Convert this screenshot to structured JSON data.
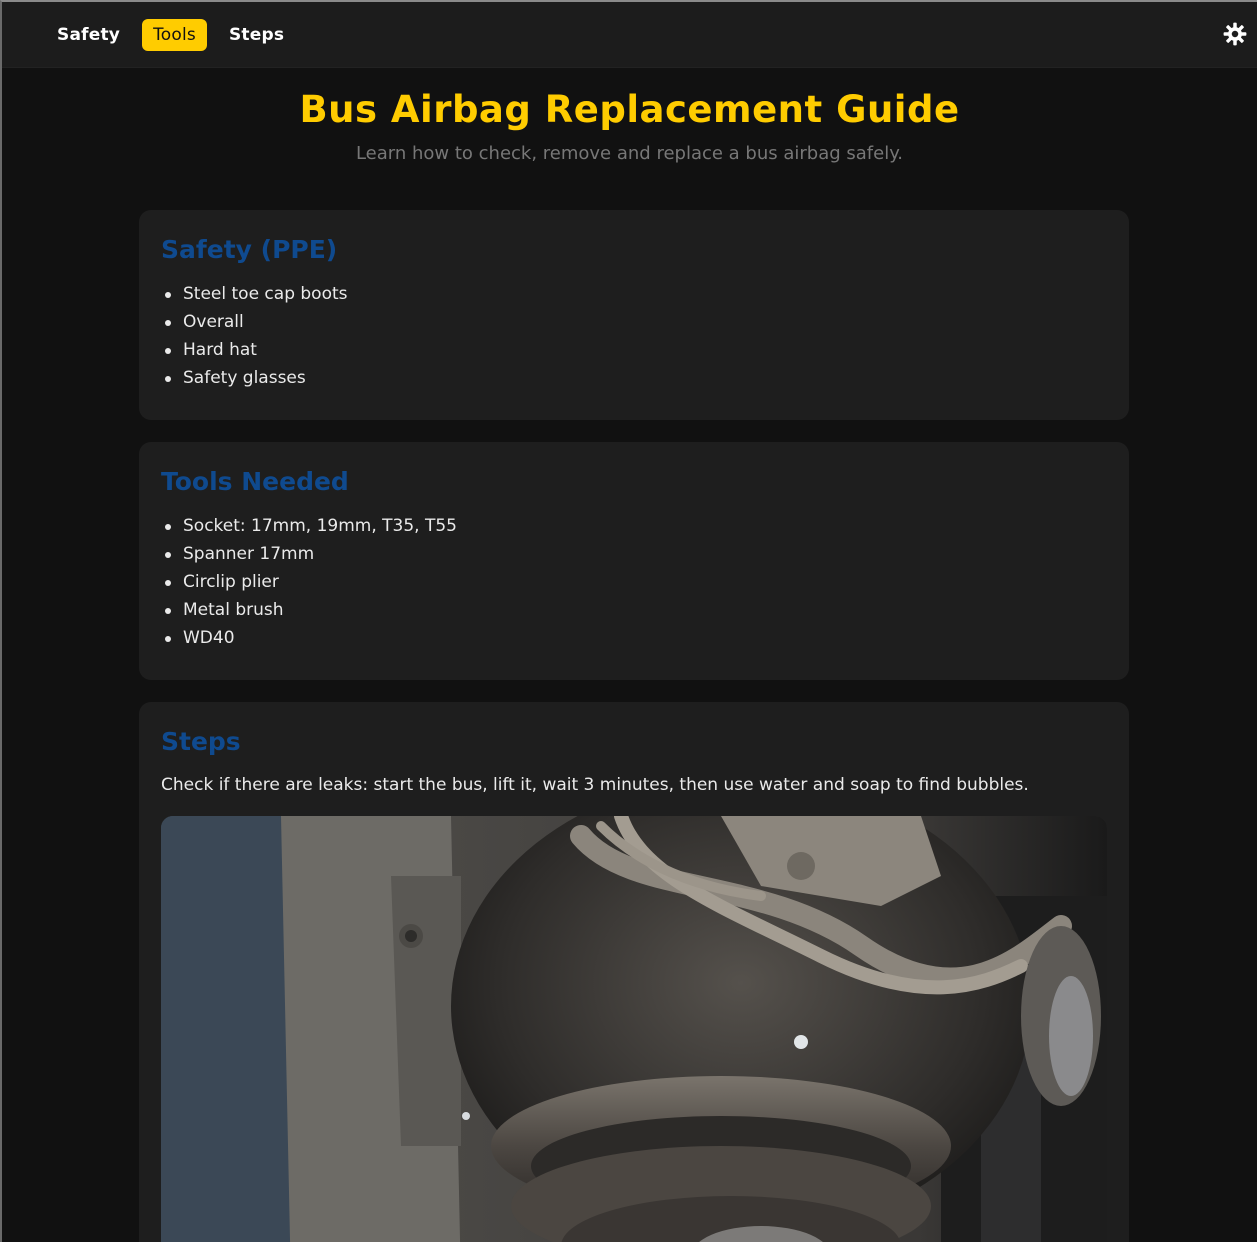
{
  "nav": {
    "items": [
      {
        "label": "Safety",
        "active": false
      },
      {
        "label": "Tools",
        "active": true
      },
      {
        "label": "Steps",
        "active": false
      }
    ],
    "theme_icon": "gear-icon"
  },
  "header": {
    "title": "Bus Airbag Replacement Guide",
    "subtitle": "Learn how to check, remove and replace a bus airbag safely."
  },
  "safety": {
    "heading": "Safety (PPE)",
    "items": [
      "Steel toe cap boots",
      "Overall",
      "Hard hat",
      "Safety glasses"
    ]
  },
  "tools": {
    "heading": "Tools Needed",
    "items": [
      "Socket: 17mm, 19mm, T35, T55",
      "Spanner 17mm",
      "Circlip plier",
      "Metal brush",
      "WD40"
    ]
  },
  "steps": {
    "heading": "Steps",
    "step1": "Check if there are leaks: start the bus, lift it, wait 3 minutes, then use water and soap to find bubbles."
  },
  "colors": {
    "accent": "#ffcc00",
    "heading_blue": "#0f4a8f",
    "background": "#111111",
    "card": "#1e1e1e"
  }
}
